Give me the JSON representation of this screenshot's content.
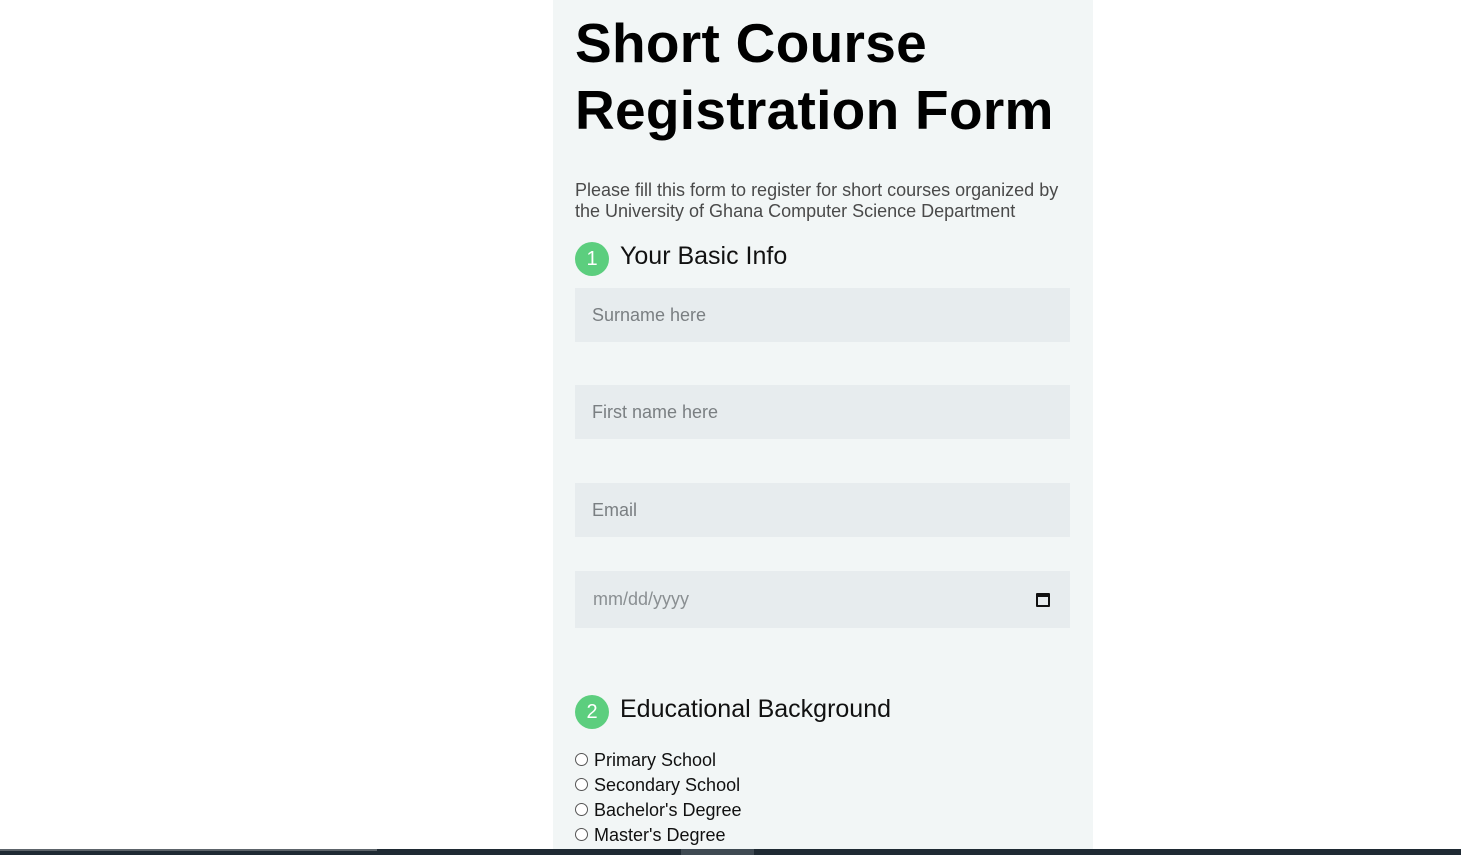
{
  "form": {
    "title": "Short Course Registration Form",
    "intro": "Please fill this form to register for short courses organized by the University of Ghana Computer Science Department",
    "sections": [
      {
        "number": "1",
        "title": "Your Basic Info"
      },
      {
        "number": "2",
        "title": "Educational Background"
      }
    ],
    "fields": {
      "surname_placeholder": "Surname here",
      "firstname_placeholder": "First name here",
      "email_placeholder": "Email",
      "date_placeholder": "mm/dd/yyyy"
    },
    "education_options": [
      "Primary School",
      "Secondary School",
      "Bachelor's Degree",
      "Master's Degree"
    ]
  },
  "colors": {
    "card_background": "#f2f6f6",
    "field_background": "#e7ecee",
    "step_badge": "#5cce7e"
  },
  "icons": {
    "date_picker": "calendar-icon"
  }
}
